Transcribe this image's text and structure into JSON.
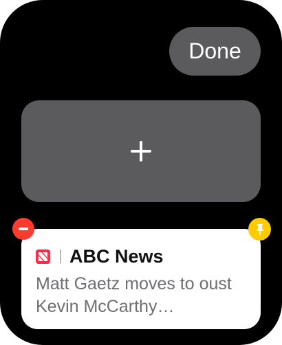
{
  "toolbar": {
    "done_label": "Done"
  },
  "add_tile": {
    "icon": "plus-icon"
  },
  "widget": {
    "app_icon": "apple-news-icon",
    "source": "ABC News",
    "headline": "Matt Gaetz moves to oust Kevin McCarthy…",
    "remove_icon": "minus-icon",
    "pin_icon": "pin-icon"
  },
  "colors": {
    "background": "#000000",
    "tile": "#5b5b5e",
    "card": "#ffffff",
    "remove": "#ff3b30",
    "pin": "#ffcc00",
    "news_brand": "#fa2d48",
    "headline_text": "#6e6e73"
  }
}
